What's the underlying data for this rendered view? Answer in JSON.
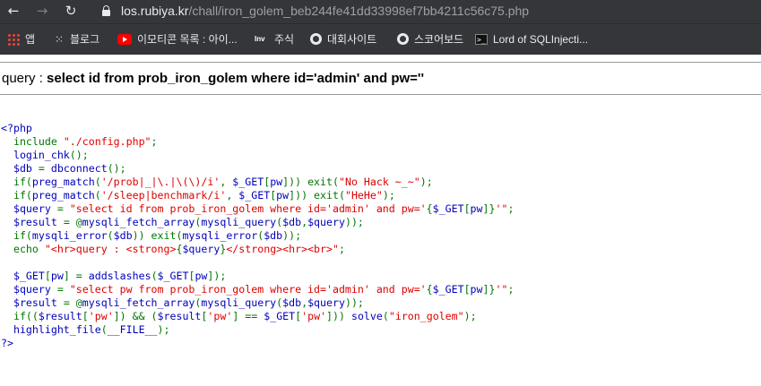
{
  "browser": {
    "nav": {
      "back": "←",
      "forward": "→",
      "reload": "↻",
      "home": "⌂"
    },
    "url": {
      "host": "los.rubiya.kr",
      "path": "/chall/iron_golem_beb244fe41dd33998ef7bb4211c56c75.php"
    },
    "bookmarks": [
      {
        "label": "앱",
        "icon": "apps-grid-icon"
      },
      {
        "label": "블로그",
        "icon": "dots-icon"
      },
      {
        "label": "이모티콘 목록 : 아이...",
        "icon": "youtube-icon"
      },
      {
        "label": "주식",
        "icon": "inv-icon"
      },
      {
        "label": "대회사이트",
        "icon": "globe-icon"
      },
      {
        "label": "스코어보드",
        "icon": "globe-icon"
      },
      {
        "label": "Lord of SQLInjecti...",
        "icon": "terminal-icon"
      }
    ]
  },
  "page": {
    "query_label": "query : ",
    "query_value": "select id from prob_iron_golem where id='admin' and pw=''"
  },
  "source_code": [
    [
      [
        "d",
        "<?php"
      ]
    ],
    [
      [
        "k",
        "  include "
      ],
      [
        "s",
        "\"./config.php\""
      ],
      [
        "k",
        ";"
      ]
    ],
    [
      [
        "d",
        "  login_chk"
      ],
      [
        "k",
        "();"
      ]
    ],
    [
      [
        "d",
        "  $db "
      ],
      [
        "k",
        "= "
      ],
      [
        "d",
        "dbconnect"
      ],
      [
        "k",
        "();"
      ]
    ],
    [
      [
        "k",
        "  if("
      ],
      [
        "d",
        "preg_match"
      ],
      [
        "k",
        "("
      ],
      [
        "s",
        "'/prob|_|\\.|\\(\\)/i'"
      ],
      [
        "k",
        ", "
      ],
      [
        "d",
        "$_GET"
      ],
      [
        "k",
        "["
      ],
      [
        "d",
        "pw"
      ],
      [
        "k",
        "])) exit("
      ],
      [
        "s",
        "\"No Hack ~_~\""
      ],
      [
        "k",
        ");"
      ]
    ],
    [
      [
        "k",
        "  if("
      ],
      [
        "d",
        "preg_match"
      ],
      [
        "k",
        "("
      ],
      [
        "s",
        "'/sleep|benchmark/i'"
      ],
      [
        "k",
        ", "
      ],
      [
        "d",
        "$_GET"
      ],
      [
        "k",
        "["
      ],
      [
        "d",
        "pw"
      ],
      [
        "k",
        "])) exit("
      ],
      [
        "s",
        "\"HeHe\""
      ],
      [
        "k",
        ");"
      ]
    ],
    [
      [
        "d",
        "  $query "
      ],
      [
        "k",
        "= "
      ],
      [
        "s",
        "\"select id from prob_iron_golem where id='admin' and pw='"
      ],
      [
        "k",
        "{"
      ],
      [
        "d",
        "$_GET"
      ],
      [
        "k",
        "["
      ],
      [
        "d",
        "pw"
      ],
      [
        "k",
        "]}"
      ],
      [
        "s",
        "'\""
      ],
      [
        "k",
        ";"
      ]
    ],
    [
      [
        "d",
        "  $result "
      ],
      [
        "k",
        "= @"
      ],
      [
        "d",
        "mysqli_fetch_array"
      ],
      [
        "k",
        "("
      ],
      [
        "d",
        "mysqli_query"
      ],
      [
        "k",
        "("
      ],
      [
        "d",
        "$db"
      ],
      [
        "k",
        ","
      ],
      [
        "d",
        "$query"
      ],
      [
        "k",
        "));"
      ]
    ],
    [
      [
        "k",
        "  if("
      ],
      [
        "d",
        "mysqli_error"
      ],
      [
        "k",
        "("
      ],
      [
        "d",
        "$db"
      ],
      [
        "k",
        ")) exit("
      ],
      [
        "d",
        "mysqli_error"
      ],
      [
        "k",
        "("
      ],
      [
        "d",
        "$db"
      ],
      [
        "k",
        "));"
      ]
    ],
    [
      [
        "k",
        "  echo "
      ],
      [
        "s",
        "\"<hr>query : <strong>"
      ],
      [
        "k",
        "{"
      ],
      [
        "d",
        "$query"
      ],
      [
        "k",
        "}"
      ],
      [
        "s",
        "</strong><hr><br>\""
      ],
      [
        "k",
        ";"
      ]
    ],
    [
      [
        "k",
        ""
      ]
    ],
    [
      [
        "d",
        "  $_GET"
      ],
      [
        "k",
        "["
      ],
      [
        "d",
        "pw"
      ],
      [
        "k",
        "] = "
      ],
      [
        "d",
        "addslashes"
      ],
      [
        "k",
        "("
      ],
      [
        "d",
        "$_GET"
      ],
      [
        "k",
        "["
      ],
      [
        "d",
        "pw"
      ],
      [
        "k",
        "]);"
      ]
    ],
    [
      [
        "d",
        "  $query "
      ],
      [
        "k",
        "= "
      ],
      [
        "s",
        "\"select pw from prob_iron_golem where id='admin' and pw='"
      ],
      [
        "k",
        "{"
      ],
      [
        "d",
        "$_GET"
      ],
      [
        "k",
        "["
      ],
      [
        "d",
        "pw"
      ],
      [
        "k",
        "]}"
      ],
      [
        "s",
        "'\""
      ],
      [
        "k",
        ";"
      ]
    ],
    [
      [
        "d",
        "  $result "
      ],
      [
        "k",
        "= @"
      ],
      [
        "d",
        "mysqli_fetch_array"
      ],
      [
        "k",
        "("
      ],
      [
        "d",
        "mysqli_query"
      ],
      [
        "k",
        "("
      ],
      [
        "d",
        "$db"
      ],
      [
        "k",
        ","
      ],
      [
        "d",
        "$query"
      ],
      [
        "k",
        "));"
      ]
    ],
    [
      [
        "k",
        "  if(("
      ],
      [
        "d",
        "$result"
      ],
      [
        "k",
        "["
      ],
      [
        "s",
        "'pw'"
      ],
      [
        "k",
        "]) && ("
      ],
      [
        "d",
        "$result"
      ],
      [
        "k",
        "["
      ],
      [
        "s",
        "'pw'"
      ],
      [
        "k",
        "] == "
      ],
      [
        "d",
        "$_GET"
      ],
      [
        "k",
        "["
      ],
      [
        "s",
        "'pw'"
      ],
      [
        "k",
        "])) "
      ],
      [
        "d",
        "solve"
      ],
      [
        "k",
        "("
      ],
      [
        "s",
        "\"iron_golem\""
      ],
      [
        "k",
        ");"
      ]
    ],
    [
      [
        "d",
        "  highlight_file"
      ],
      [
        "k",
        "("
      ],
      [
        "d",
        "__FILE__"
      ],
      [
        "k",
        ");"
      ]
    ],
    [
      [
        "d",
        "?>"
      ]
    ]
  ],
  "colors": {
    "chrome_bg": "#35363a",
    "php_keyword": "#007700",
    "php_default": "#0000bb",
    "php_string": "#dd0000"
  }
}
